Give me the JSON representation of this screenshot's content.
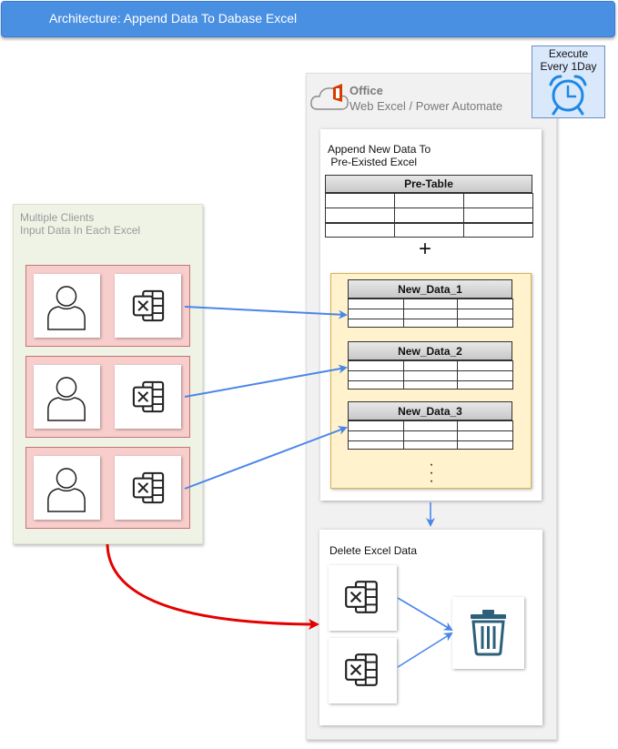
{
  "header": {
    "title": "Architecture: Append Data To Dabase Excel"
  },
  "clients": {
    "label_line1": "Multiple Clients",
    "label_line2": "Input Data In Each Excel",
    "rows": 3
  },
  "office": {
    "title": "Office",
    "subtitle": "Web Excel / Power  Automate"
  },
  "schedule": {
    "line1": "Execute",
    "line2": "Every 1Day"
  },
  "append": {
    "label_line1": "Append New Data To",
    "label_line2": " Pre-Existed Excel",
    "pre_table": "Pre-Table",
    "plus": "+",
    "tables": [
      "New_Data_1",
      "New_Data_2",
      "New_Data_3"
    ]
  },
  "delete": {
    "label": "Delete Excel Data"
  },
  "icons": {
    "user": "user-icon",
    "excel": "excel-icon",
    "cloud": "cloud-icon",
    "office_logo": "office-logo-icon",
    "clock": "alarm-clock-icon",
    "trash": "trash-icon",
    "ellipsis": "vertical-ellipsis-icon"
  },
  "colors": {
    "title_bar": "#4a90e2",
    "client_group": "#eef3e6",
    "client_row": "#f8cecc",
    "new_data_bg": "#fff2cc",
    "execute_box": "#dae8fc",
    "arrow_blue": "#4a86e8",
    "arrow_red": "#e50000",
    "office_logo": "#d83b01",
    "clock_blue": "#1e88e5",
    "trash": "#2c5f7a"
  }
}
